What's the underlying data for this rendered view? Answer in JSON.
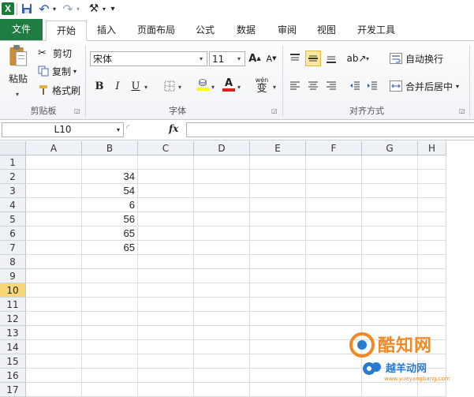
{
  "qat": {
    "app_icon": "excel-icon",
    "app_letter": "X",
    "undo_glyph": "↶",
    "redo_glyph": "↷",
    "tool_glyph": "⚒",
    "more_glyph": "▾"
  },
  "tabs": {
    "file": "文件",
    "home": "开始",
    "insert": "插入",
    "page_layout": "页面布局",
    "formulas": "公式",
    "data": "数据",
    "review": "审阅",
    "view": "视图",
    "developer": "开发工具"
  },
  "ribbon": {
    "clipboard": {
      "paste": "粘贴",
      "cut": "剪切",
      "copy": "复制",
      "format_painter": "格式刷",
      "group_label": "剪贴板"
    },
    "font": {
      "font_name": "宋体",
      "font_size": "11",
      "grow": "A",
      "shrink": "A",
      "bold": "B",
      "italic": "I",
      "underline": "U",
      "color_a": "A",
      "wen": "wén",
      "wen_char": "变",
      "group_label": "字体"
    },
    "alignment": {
      "wrap_text": "自动换行",
      "merge_center": "合并后居中",
      "group_label": "对齐方式"
    }
  },
  "formula_bar": {
    "name_box": "L10",
    "fx": "fx",
    "content": ""
  },
  "sheet": {
    "columns": [
      "A",
      "B",
      "C",
      "D",
      "E",
      "F",
      "G",
      "H"
    ],
    "rows": [
      "1",
      "2",
      "3",
      "4",
      "5",
      "6",
      "7",
      "8",
      "9",
      "10",
      "11",
      "12",
      "13",
      "14",
      "15",
      "16",
      "17"
    ],
    "active_row": "10",
    "b_values": [
      "",
      "34",
      "54",
      "6",
      "56",
      "65",
      "65"
    ]
  },
  "watermark": {
    "brand": "酷知网",
    "brand2": "越羊动网",
    "url": "www.yueyangbang.com"
  },
  "colors": {
    "file_tab": "#1f7c42",
    "active_row_header": "#f8d776",
    "highlight_button": "#fce79a",
    "fill_yellow": "#ffff00",
    "font_red": "#e02020"
  }
}
